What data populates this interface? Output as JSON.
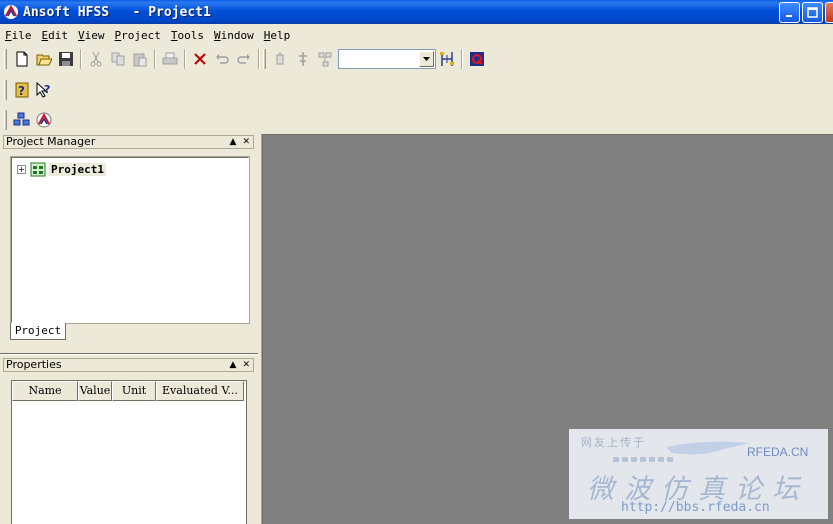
{
  "window": {
    "title": "Ansoft HFSS   - Project1",
    "buttons": [
      "minimize",
      "maximize",
      "close"
    ]
  },
  "menu": [
    {
      "label": "File",
      "accel": "F",
      "rest": "ile"
    },
    {
      "label": "Edit",
      "accel": "E",
      "rest": "dit"
    },
    {
      "label": "View",
      "accel": "V",
      "rest": "iew"
    },
    {
      "label": "Project",
      "accel": "P",
      "rest": "roject"
    },
    {
      "label": "Tools",
      "accel": "T",
      "rest": "ools"
    },
    {
      "label": "Window",
      "accel": "W",
      "rest": "indow"
    },
    {
      "label": "Help",
      "accel": "H",
      "rest": "elp"
    }
  ],
  "toolbar": {
    "icons": [
      "new-icon",
      "open-icon",
      "save-icon",
      "cut-icon",
      "copy-icon",
      "paste-icon",
      "print-icon",
      "delete-icon",
      "undo-icon",
      "redo-icon",
      "dataset-icon",
      "solve-icon",
      "network-icon",
      "setup-dropdown",
      "add-port-icon",
      "validate-icon"
    ],
    "dropdown_value": ""
  },
  "toolbar2": {
    "icons": [
      "help-topics-icon",
      "whats-this-icon"
    ]
  },
  "toolbar3": {
    "icons": [
      "insert-design-icon",
      "hfss-icon"
    ]
  },
  "project_manager": {
    "title": "Project Manager",
    "tree": [
      {
        "label": "Project1",
        "expanded": false
      }
    ],
    "tab": "Project"
  },
  "properties": {
    "title": "Properties",
    "columns": [
      "Name",
      "Value",
      "Unit",
      "Evaluated V..."
    ]
  },
  "watermark": {
    "small": "网友上传于",
    "brand": "RFEDA.CN",
    "big": "微波仿真论坛",
    "url": "http://bbs.rfeda.cn"
  },
  "colors": {
    "titlebar": "#0054e3",
    "face": "#ece9d8",
    "workspace": "#808080"
  }
}
